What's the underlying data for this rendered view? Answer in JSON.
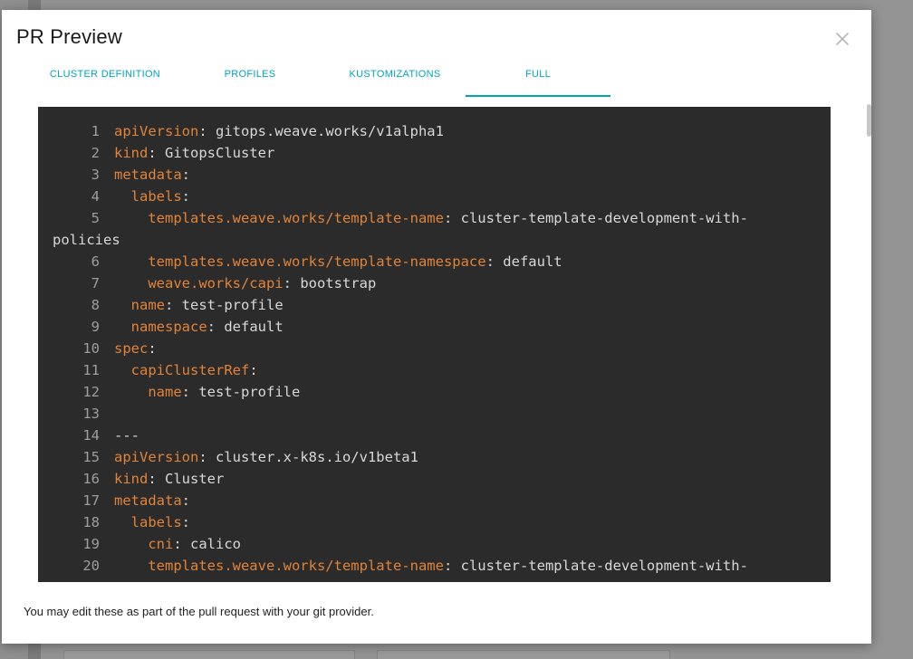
{
  "modal": {
    "title": "PR Preview",
    "footer_note": "You may edit these as part of the pull request with your git provider."
  },
  "tabs": [
    {
      "label": "CLUSTER DEFINITION",
      "active": false
    },
    {
      "label": "PROFILES",
      "active": false
    },
    {
      "label": "KUSTOMIZATIONS",
      "active": false
    },
    {
      "label": "FULL",
      "active": true
    }
  ],
  "icons": {
    "close": "close-icon"
  },
  "colors": {
    "accent": "#00a3c4",
    "code_bg": "#2b2b2b",
    "yaml_key": "#e0843a",
    "code_text": "#d8d8d8",
    "line_number": "#9e9e9e"
  },
  "code": [
    {
      "n": "1",
      "indent": "",
      "key": "apiVersion",
      "sep": ": ",
      "value": "gitops.weave.works/v1alpha1"
    },
    {
      "n": "2",
      "indent": "",
      "key": "kind",
      "sep": ": ",
      "value": "GitopsCluster"
    },
    {
      "n": "3",
      "indent": "",
      "key": "metadata",
      "sep": ":",
      "value": ""
    },
    {
      "n": "4",
      "indent": "  ",
      "key": "labels",
      "sep": ":",
      "value": ""
    },
    {
      "n": "5",
      "indent": "    ",
      "key": "templates.weave.works/template-name",
      "sep": ": ",
      "value": "cluster-template-development-with-policies"
    },
    {
      "n": "6",
      "indent": "    ",
      "key": "templates.weave.works/template-namespace",
      "sep": ": ",
      "value": "default"
    },
    {
      "n": "7",
      "indent": "    ",
      "key": "weave.works/capi",
      "sep": ": ",
      "value": "bootstrap"
    },
    {
      "n": "8",
      "indent": "  ",
      "key": "name",
      "sep": ": ",
      "value": "test-profile"
    },
    {
      "n": "9",
      "indent": "  ",
      "key": "namespace",
      "sep": ": ",
      "value": "default"
    },
    {
      "n": "10",
      "indent": "",
      "key": "spec",
      "sep": ":",
      "value": ""
    },
    {
      "n": "11",
      "indent": "  ",
      "key": "capiClusterRef",
      "sep": ":",
      "value": ""
    },
    {
      "n": "12",
      "indent": "    ",
      "key": "name",
      "sep": ": ",
      "value": "test-profile"
    },
    {
      "n": "13",
      "indent": "",
      "key": "",
      "sep": "",
      "value": ""
    },
    {
      "n": "14",
      "indent": "",
      "key": "",
      "sep": "",
      "value": "---"
    },
    {
      "n": "15",
      "indent": "",
      "key": "apiVersion",
      "sep": ": ",
      "value": "cluster.x-k8s.io/v1beta1"
    },
    {
      "n": "16",
      "indent": "",
      "key": "kind",
      "sep": ": ",
      "value": "Cluster"
    },
    {
      "n": "17",
      "indent": "",
      "key": "metadata",
      "sep": ":",
      "value": ""
    },
    {
      "n": "18",
      "indent": "  ",
      "key": "labels",
      "sep": ":",
      "value": ""
    },
    {
      "n": "19",
      "indent": "    ",
      "key": "cni",
      "sep": ": ",
      "value": "calico"
    },
    {
      "n": "20",
      "indent": "    ",
      "key": "templates.weave.works/template-name",
      "sep": ": ",
      "value": "cluster-template-development-with-"
    }
  ]
}
